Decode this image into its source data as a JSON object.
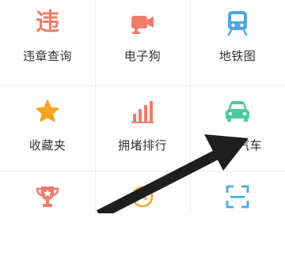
{
  "grid": {
    "items": [
      {
        "label": "违章查询",
        "icon": "violation-icon",
        "glyph": "违",
        "color": "#f07b6b"
      },
      {
        "label": "电子狗",
        "icon": "camera-icon",
        "color": "#f07b6b"
      },
      {
        "label": "地铁图",
        "icon": "subway-icon",
        "color": "#4aa8e8"
      },
      {
        "label": "收藏夹",
        "icon": "star-icon",
        "color": "#f5a623"
      },
      {
        "label": "拥堵排行",
        "icon": "bar-chart-icon",
        "color": "#f07b6b"
      },
      {
        "label": "连接汽车",
        "icon": "car-icon",
        "color": "#4cc9a0"
      },
      {
        "label": "",
        "icon": "trophy-icon",
        "color": "#f07b6b"
      },
      {
        "label": "",
        "icon": "clock-icon",
        "color": "#f5a623"
      },
      {
        "label": "",
        "icon": "scan-icon",
        "color": "#4aa8e8"
      }
    ]
  },
  "colors": {
    "text": "#333333",
    "divider": "#ececec",
    "arrow": "#1e1e1e"
  }
}
